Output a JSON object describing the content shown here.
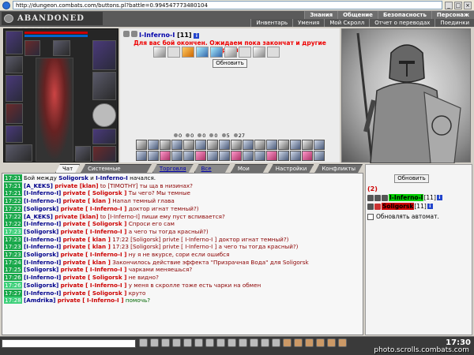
{
  "browser": {
    "url": "http://dungeon.combats.com/buttons.pl?battle=0.994547773480104"
  },
  "header": {
    "logo": "ABANDONED PLAIN",
    "menu_top": [
      "Знания",
      "Общение",
      "Безопасность",
      "Персонаж"
    ],
    "menu_bottom": [
      "Инвентарь",
      "Умения",
      "Мой Скролл",
      "Отчет о переводах",
      "Поединки"
    ]
  },
  "battle": {
    "player_name": "I-Inferno-I",
    "player_level": "[11]",
    "info_glyph": "i",
    "waiting_text": "Для вас бой окончен. Ожидаем пока закончат и другие игроки...",
    "refresh_label": "Обновить",
    "counts": [
      "0",
      "0",
      "0",
      "0",
      "5",
      "27"
    ]
  },
  "tabs": [
    {
      "label": "Чат",
      "active": true
    },
    {
      "label": "Системные сообщения"
    },
    {
      "label": "Торговля",
      "link": true
    },
    {
      "label": "Все логи",
      "link": true
    },
    {
      "label": "Мои логи"
    },
    {
      "label": "Настройки"
    },
    {
      "label": "Конфликты"
    }
  ],
  "chat": [
    {
      "time": "17:21",
      "pre": "Бой между и ",
      "sys": true,
      "text": "Бой между и Soligorsk и I-Inferno-I начался."
    },
    {
      "time": "17:21",
      "name": "[A_KEKS]",
      "priv": "private [klan]",
      "msg": "to [TIMOTHY] ты ща в низинах?"
    },
    {
      "time": "17:21",
      "name": "[I-Inferno-I]",
      "priv": "private [ Soligorsk ]",
      "msg": "Ты чего? Мы темные"
    },
    {
      "time": "17:22",
      "name": "[I-Inferno-I]",
      "priv": "private [ klan ]",
      "msg": "Напал темный глава"
    },
    {
      "time": "17:22",
      "name": "[Soligorsk]",
      "priv": "private [ I-Inferno-I ]",
      "msg": "доктор игнат темный?)"
    },
    {
      "time": "17:22",
      "name": "[A_KEKS]",
      "priv": "private [klan]",
      "msg": "to [I-Inferno-I] пиши ему пуст вспивается?"
    },
    {
      "time": "17:22",
      "name": "[I-Inferno-I]",
      "priv": "private [ Soligorsk ]",
      "msg": "Спроси его сам"
    },
    {
      "time": "17:23",
      "name": "[Soligorsk]",
      "priv": "private [ I-Inferno-I ]",
      "msg": "а чего ты тогда красный?)",
      "hl": true
    },
    {
      "time": "17:23",
      "name": "[I-Inferno-I]",
      "priv": "private [ klan ]",
      "msg": "17:22 [Soligorsk] privte [ I-Inferno-I ] доктор игнат темный?)"
    },
    {
      "time": "17:23",
      "name": "[I-Inferno-I]",
      "priv": "private [ klan ]",
      "msg": "17:23 [Soligorsk] privte [ I-Inferno-I ] а чего ты тогда красный?)"
    },
    {
      "time": "17:23",
      "name": "[Soligorsk]",
      "priv": "private [ I-Inferno-I ]",
      "msg": "ну я не вкурсе, сори если ошибся"
    },
    {
      "time": "17:24",
      "name": "[I-Inferno-I]",
      "priv": "private [ klan ]",
      "msg": "Закончилось действие эффекта \"Призрачная Вода\" для Soligorsk"
    },
    {
      "time": "17:25",
      "name": "[Soligorsk]",
      "priv": "private [ I-Inferno-I ]",
      "msg": "чарками меняешься?"
    },
    {
      "time": "17:26",
      "name": "[I-Inferno-I]",
      "priv": "private [ Soligorsk ]",
      "msg": "не видно?"
    },
    {
      "time": "17:26",
      "name": "[Soligorsk]",
      "priv": "private [ I-Inferno-I ]",
      "msg": "у меня в скролле тоже есть чарки на обмен",
      "hl": true
    },
    {
      "time": "17:27",
      "name": "[I-Inferno-I]",
      "priv": "private [ Soligorsk ]",
      "msg": "круто"
    },
    {
      "time": "17:28",
      "name": "[Amdrika]",
      "priv": "private [ I-Inferno-I ]",
      "msg": "помочь?",
      "hl": true
    }
  ],
  "chat_sys": {
    "between": "Бой между",
    "p1": "Soligorsk",
    "and": "и",
    "p2": "I-Inferno-I",
    "started": "начался."
  },
  "right": {
    "refresh_label": "Обновить",
    "count": "(2)",
    "players": [
      {
        "name": "I-Inferno-I",
        "level": "[11]",
        "color": "green"
      },
      {
        "name": "Soligorsk",
        "level": "[11]",
        "color": "red"
      }
    ],
    "info_glyph": "i",
    "auto_label": "Обновлять автомат."
  },
  "bottom": {
    "clock": "17:30",
    "watermark": "photo.scrolls.combats.com"
  }
}
